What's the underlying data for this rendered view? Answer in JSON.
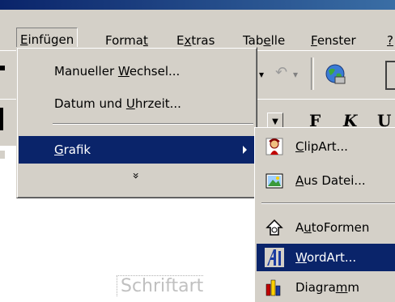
{
  "menubar": {
    "items": [
      {
        "pre": "",
        "key": "E",
        "post": "infügen"
      },
      {
        "pre": "Forma",
        "key": "t",
        "post": ""
      },
      {
        "pre": "E",
        "key": "x",
        "post": "tras"
      },
      {
        "pre": "Tab",
        "key": "e",
        "post": "lle"
      },
      {
        "pre": "",
        "key": "F",
        "post": "enster"
      },
      {
        "pre": "",
        "key": "?",
        "post": ""
      }
    ]
  },
  "toolbar": {
    "bold": "F",
    "italic": "K",
    "underline": "U",
    "undo_glyph": "↶"
  },
  "main_menu": {
    "items": [
      {
        "pre": "Manueller ",
        "key": "W",
        "post": "echsel..."
      },
      {
        "pre": "Datum und ",
        "key": "U",
        "post": "hrzeit..."
      },
      {
        "pre": "",
        "key": "G",
        "post": "rafik"
      }
    ],
    "expand_glyph": "»"
  },
  "sub_menu": {
    "items": [
      {
        "pre": "",
        "key": "C",
        "post": "lipArt..."
      },
      {
        "pre": "",
        "key": "A",
        "post": "us Datei..."
      },
      {
        "pre": "A",
        "key": "u",
        "post": "toFormen"
      },
      {
        "pre": "",
        "key": "W",
        "post": "ordArt..."
      },
      {
        "pre": "Diagra",
        "key": "m",
        "post": "m"
      }
    ]
  },
  "document": {
    "partial_text": "Schriftart"
  },
  "colors": {
    "face": "#d4d0c8",
    "highlight": "#0a246a",
    "title": "#0a246a"
  }
}
